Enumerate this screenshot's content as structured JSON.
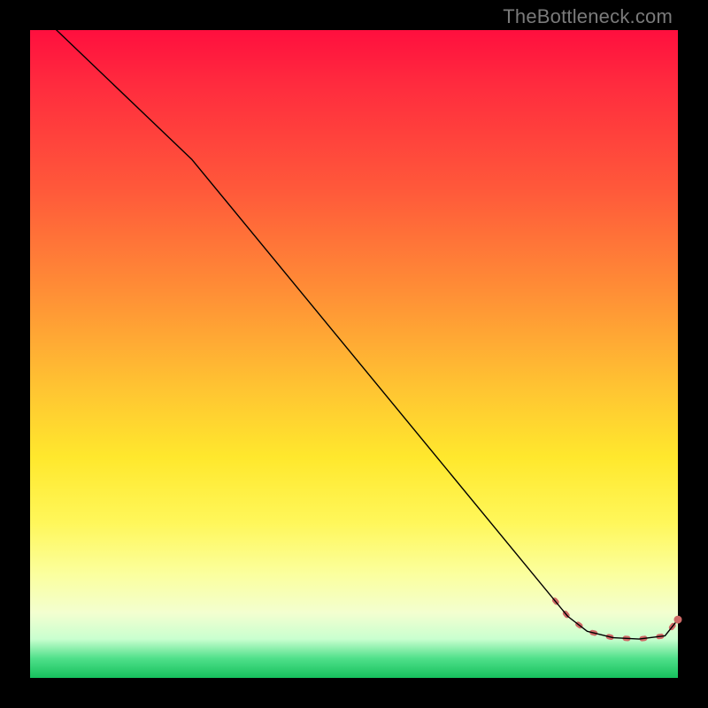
{
  "watermark": "TheBottleneck.com",
  "colors": {
    "line": "#000000",
    "dotted": "#cf6a67",
    "marker": "#cf6a67"
  },
  "chart_data": {
    "type": "line",
    "title": "",
    "xlabel": "",
    "ylabel": "",
    "xlim": [
      0,
      100
    ],
    "ylim": [
      0,
      100
    ],
    "grid": false,
    "series": [
      {
        "name": "main-curve",
        "style": "solid-black",
        "x": [
          2,
          25,
          83,
          86,
          90,
          94,
          98,
          100
        ],
        "y": [
          102,
          80,
          9.5,
          7.2,
          6.2,
          6.0,
          6.5,
          9.0
        ]
      },
      {
        "name": "bottom-dotted",
        "style": "dotted-salmon",
        "x": [
          81,
          83,
          86,
          90,
          94,
          98,
          100
        ],
        "y": [
          12.0,
          9.5,
          7.2,
          6.2,
          6.0,
          6.5,
          9.0
        ]
      }
    ],
    "markers": [
      {
        "x": 100,
        "y": 9.0
      }
    ],
    "gradient_stops": [
      {
        "pct": 0,
        "color": "#ff0f3e"
      },
      {
        "pct": 25,
        "color": "#ff5a3a"
      },
      {
        "pct": 55,
        "color": "#ffc332"
      },
      {
        "pct": 76,
        "color": "#fff75a"
      },
      {
        "pct": 94,
        "color": "#c9ffcf"
      },
      {
        "pct": 100,
        "color": "#16c05d"
      }
    ]
  }
}
